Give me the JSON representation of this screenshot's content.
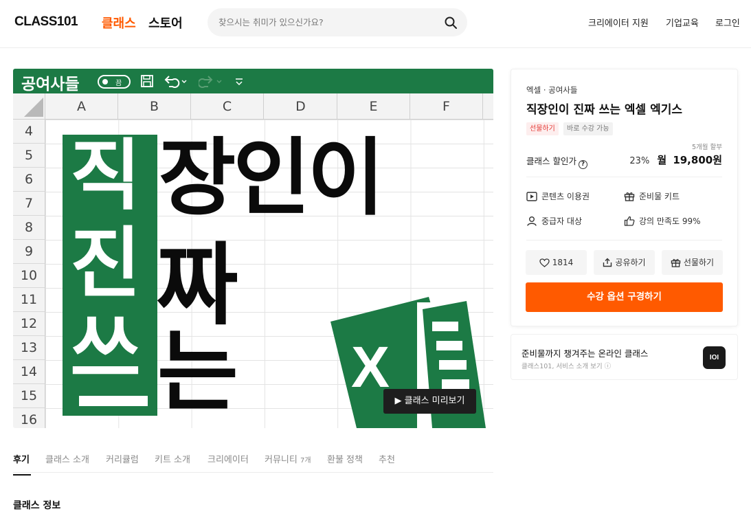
{
  "header": {
    "logo": "CLASS101",
    "nav_classes": "클래스",
    "nav_store": "스토어",
    "search_placeholder": "찾으시는 취미가 있으신가요?",
    "links": [
      "크리에이터 지원",
      "기업교육",
      "로그인"
    ]
  },
  "hero": {
    "excel_title": "공여사들",
    "toggle_label": "끔",
    "columns": [
      "A",
      "B",
      "C",
      "D",
      "E",
      "F"
    ],
    "rows": [
      "4",
      "5",
      "6",
      "7",
      "8",
      "9",
      "10",
      "11",
      "12",
      "13",
      "14",
      "15",
      "16"
    ],
    "vertical_chars": [
      "직",
      "진",
      "쓰"
    ],
    "headline_line1": "장인이",
    "headline_line2": "짜",
    "headline_line3": "는",
    "logo_x": "X",
    "preview_button": "▶ 클래스 미리보기"
  },
  "tabs": [
    {
      "label": "후기",
      "active": true
    },
    {
      "label": "클래스 소개"
    },
    {
      "label": "커리큘럼"
    },
    {
      "label": "키트 소개"
    },
    {
      "label": "크리에이터"
    },
    {
      "label": "커뮤니티",
      "count": "7개"
    },
    {
      "label": "환불 정책"
    },
    {
      "label": "추천"
    }
  ],
  "section_title": "클래스 정보",
  "card": {
    "category": "엑셀 · 공여사들",
    "title": "직장인이 진짜 쓰는 엑셀 엑기스",
    "badge_gift": "선물하기",
    "badge_instant": "바로 수강 가능",
    "installment": "5개월 할부",
    "price_label": "클래스 할인가",
    "discount": "23%",
    "month_prefix": "월",
    "price": "19,800원",
    "features": [
      "콘텐츠 이용권",
      "준비물 키트",
      "중급자 대상",
      "강의 만족도 99%"
    ],
    "like_count": "1814",
    "share_label": "공유하기",
    "gift_label": "선물하기",
    "cta": "수강 옵션 구경하기"
  },
  "promo": {
    "title": "준비물까지 챙겨주는 온라인 클래스",
    "subtitle": "클래스101, 서비스 소개 보기",
    "logo": "IOI"
  },
  "colors": {
    "brand_orange": "#ff5a00",
    "excel_green": "#1c7a45",
    "badge_red": "#e53935"
  }
}
